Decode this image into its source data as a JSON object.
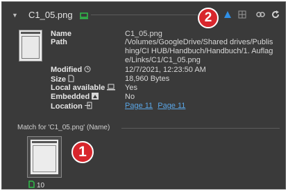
{
  "header": {
    "filename": "C1_05.png",
    "icons": [
      "chevron-down-icon",
      "monitor-icon",
      "warning-triangle-icon",
      "grid-icon",
      "relink-icon",
      "refresh-icon"
    ]
  },
  "badges": {
    "one": "1",
    "two": "2"
  },
  "details": {
    "labels": {
      "name": "Name",
      "path": "Path",
      "modified": "Modified",
      "size": "Size",
      "local_available": "Local available",
      "embedded": "Embedded",
      "location": "Location"
    },
    "values": {
      "name": "C1_05.png",
      "path_line1": "/Volumes/GoogleDrive/Shared drives/Publis",
      "path_line2": "hing/CI HUB/Handbuch/Handbuch/1. Auflag",
      "path_line3": "e/Links/C1/C1_05.png",
      "modified": "12/7/2021, 12:23:50 AM",
      "size": "18,960 Bytes",
      "local_available": "Yes",
      "embedded": "No",
      "location_links": [
        "Page 11",
        "Page 11"
      ]
    }
  },
  "match": {
    "label": "Match for 'C1_05.png' (Name)"
  },
  "match_item": {
    "page_count": "10"
  },
  "colors": {
    "panel": "#3a3a3a",
    "link": "#5aa6e6",
    "badge": "#d8262c",
    "status_green": "#2fbf4a",
    "warning": "#2f8fe6"
  }
}
